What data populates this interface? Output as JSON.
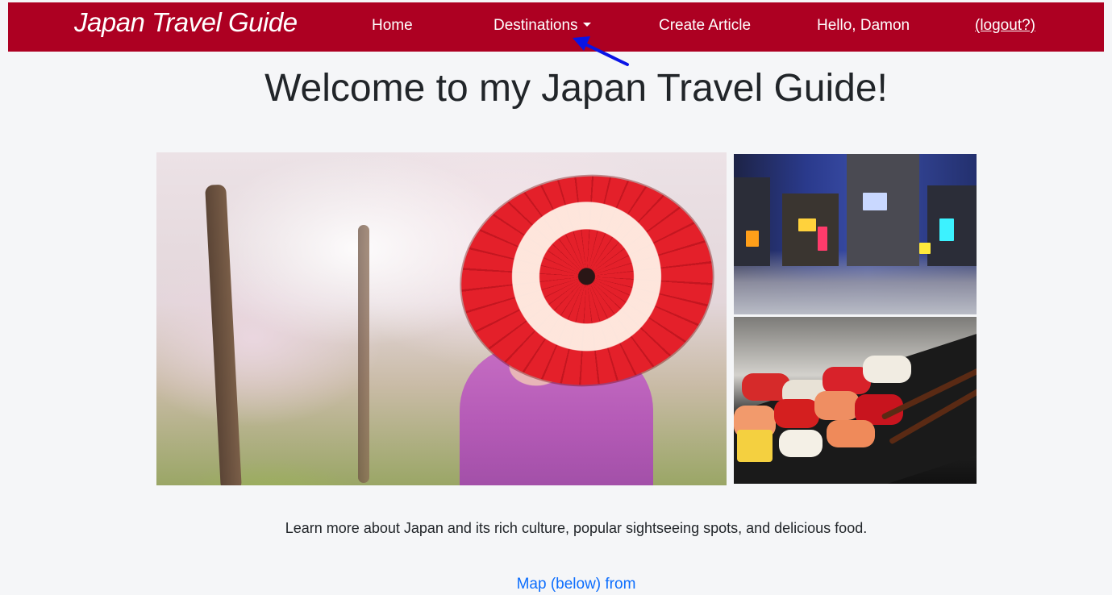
{
  "navbar": {
    "brand": "Japan Travel Guide",
    "links": {
      "home": "Home",
      "destinations": "Destinations",
      "create_article": "Create Article",
      "greeting": "Hello, Damon",
      "logout": "(logout?)"
    },
    "background_color": "#ad0022"
  },
  "main": {
    "title": "Welcome to my Japan Travel Guide!",
    "tagline": "Learn more about Japan and its rich culture, popular sightseeing spots, and delicious food.",
    "map_link": "Map (below) from"
  },
  "icons": {
    "dropdown": "caret-down-icon",
    "annotation": "blue-arrow-icon"
  },
  "colors": {
    "link": "#0d6efd",
    "annotation_arrow": "#0a14e6"
  }
}
